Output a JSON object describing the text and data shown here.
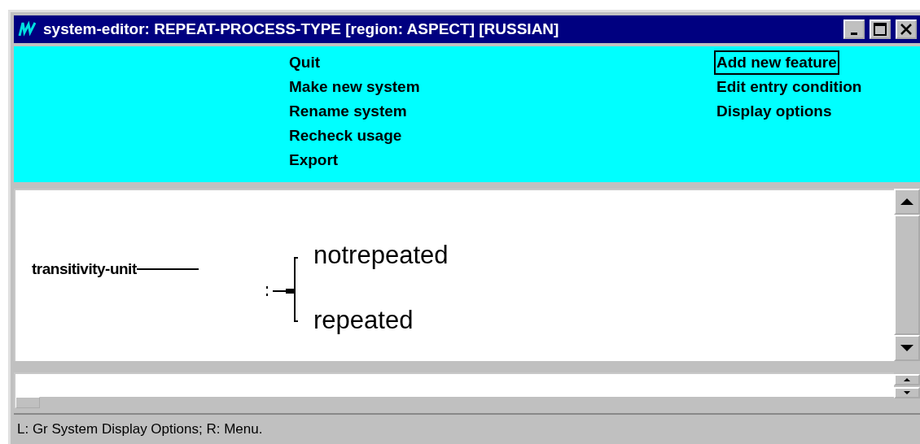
{
  "window": {
    "title": "system-editor: REPEAT-PROCESS-TYPE [region: ASPECT] [RUSSIAN]"
  },
  "menu_columns": [
    [
      {
        "label": "Quit",
        "selected": false
      },
      {
        "label": "Make new system",
        "selected": false
      },
      {
        "label": "Rename system",
        "selected": false
      },
      {
        "label": "Recheck usage",
        "selected": false
      },
      {
        "label": "Export",
        "selected": false
      }
    ],
    [
      {
        "label": "Add new feature",
        "selected": true
      },
      {
        "label": "Edit entry condition",
        "selected": false
      },
      {
        "label": "Display options",
        "selected": false
      }
    ]
  ],
  "network": {
    "entry": "transitivity-unit",
    "features": [
      "notrepeated",
      "repeated"
    ]
  },
  "status_bar": "L: Gr System Display Options; R: Menu."
}
